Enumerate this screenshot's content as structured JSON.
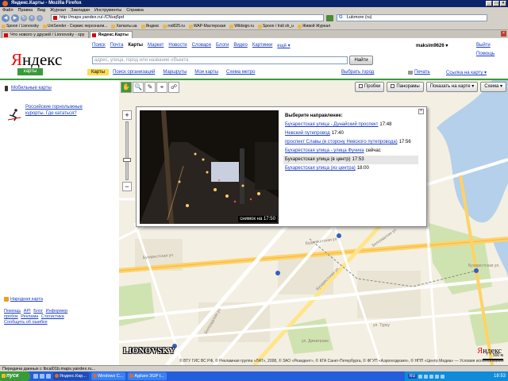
{
  "window": {
    "title": "Яндекс.Карты - Mozilla Firefox",
    "buttons": [
      "_",
      "□",
      "×"
    ]
  },
  "menu": [
    "Файл",
    "Правка",
    "Вид",
    "Журнал",
    "Закладки",
    "Инструменты",
    "Справка"
  ],
  "nav": {
    "url": "http://maps.yandex.ru/-/CNuq5pd",
    "search_value": "Lukmore (ru)"
  },
  "bookmarks": [
    "Spoon / Lionovsky",
    "UniSender - Сервис персонали...",
    "Хаткаты.ua",
    "Яндекс",
    "rod025.ru",
    "WAP-Мастерская",
    "Wildsign.ru",
    "Spoon / Indi sh_u",
    "Живой Журнал"
  ],
  "tabs": [
    {
      "label": "Что нового у друзей / Lionovsky - spy",
      "active": false
    },
    {
      "label": "Яндекс.Карты",
      "active": true
    }
  ],
  "header": {
    "logo_letter": "Я",
    "logo_rest": "ндекс",
    "logo_sub": "карты",
    "services": [
      "Поиск",
      "Почта",
      "Карты",
      "Маркет",
      "Новости",
      "Словари",
      "Блоги",
      "Видео",
      "Картинки",
      "ещё ▾"
    ],
    "current_service": "Карты",
    "user": "maksim9626 ▾",
    "exit": "Выйти",
    "help": "Помощь",
    "search_placeholder": "адрес, улица, город или название объекта",
    "search_button": "Найти"
  },
  "maptabs": {
    "items": [
      "Карты",
      "Поиск организаций",
      "Маршруты",
      "Мои карты",
      "Схема метро"
    ],
    "active": "Карты",
    "city": "Выбрать город",
    "print": "Печать",
    "link": "Ссылка на карту ▾"
  },
  "left": {
    "mobile": "Мобильные карты",
    "resorts": "Российские горнолыжные курорты. Где кататься?",
    "people_map": "Народная карта",
    "footer_links": [
      "Помощь",
      "API",
      "Блог",
      "Информер",
      "пробок",
      "Реклама",
      "Статистика",
      "Сообщить об ошибке"
    ]
  },
  "map": {
    "tools": [
      "✋",
      "🔍",
      "✎",
      "⌖",
      "☍"
    ],
    "traffic": "Пробки",
    "panoramas": "Панорамы",
    "show_on_map": "Показать на карте ▾",
    "scheme": "Схема ▾",
    "zoom_in": "+",
    "zoom_out": "−",
    "zoom_level": 0.65,
    "watermark": "LIONOVSKY",
    "copyright": "© ВТУ ГИС ВС РФ, © Рекламная группа «ЛАТ», 2008, © ЗАО «Резидент», © КГА Санкт-Петербурга, © ФГУП «Аэрогеодезия», © НПП «Центр Медиа» — Условия использования",
    "logo_letter": "Я",
    "logo_rest": "ндекс",
    "scale": "500 м"
  },
  "popup": {
    "title": "Выберите направление:",
    "close": "×",
    "snapshot": "снимок на 17:50",
    "directions": [
      {
        "name": "Бухарестская улица - Дунайский проспект",
        "time": "17:48",
        "selected": false
      },
      {
        "name": "Невский путепровод",
        "time": "17:40",
        "selected": false
      },
      {
        "name": "проспект Славы (в сторону Невского путепровода)",
        "time": "17:56",
        "selected": false
      },
      {
        "name": "Бухарестская улица - улица Фучика",
        "time": "сейчас",
        "selected": false
      },
      {
        "name": "Бухарестская улица (в центр)",
        "time": "17:53",
        "selected": true
      },
      {
        "name": "Бухарестская улица (из центра)",
        "time": "18:00",
        "selected": false
      }
    ]
  },
  "status": "Передача данных с lbcal01b.maps.yandex.ru...",
  "taskbar": {
    "start": "пуск",
    "tasks": [
      "Яндекс.Кар...",
      "Windows C...",
      "Agitare 3GP t..."
    ],
    "lang": "RU",
    "clock": "18:53"
  }
}
